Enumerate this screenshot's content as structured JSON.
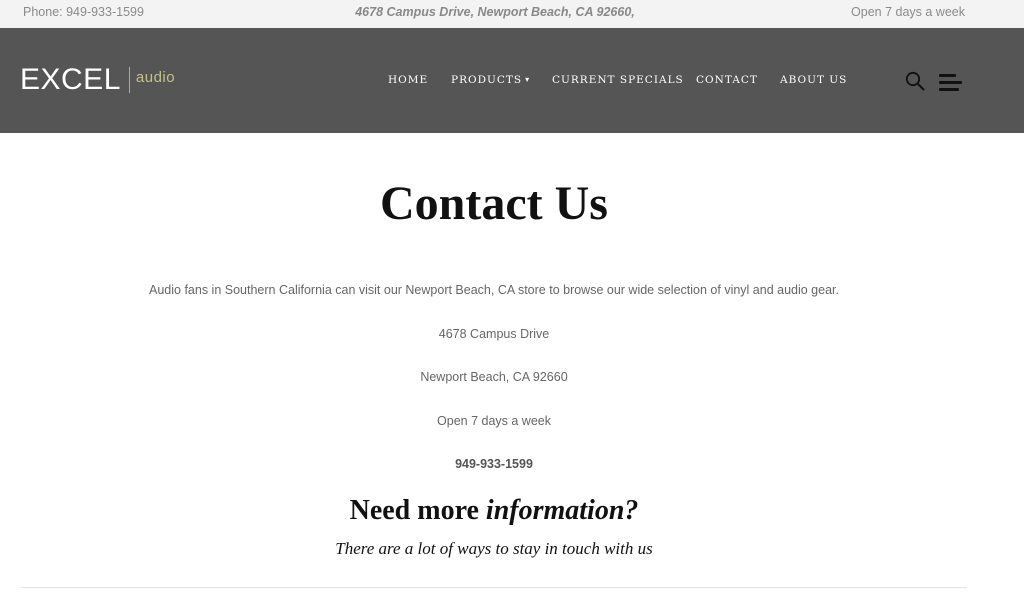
{
  "topbar": {
    "phone": "Phone: 949-933-1599",
    "address": "4678 Campus Drive, Newport Beach, CA 92660,",
    "hours": "Open 7 days a week"
  },
  "logo": {
    "primary": "EXCEL",
    "secondary": "audio"
  },
  "nav": {
    "items": [
      {
        "label": "HOME"
      },
      {
        "label": "PRODUCTS",
        "has_dropdown": true
      },
      {
        "label": "CURRENT SPECIALS"
      },
      {
        "label": "CONTACT"
      },
      {
        "label": "ABOUT US"
      }
    ],
    "caret": "▾",
    "icons": [
      "search-icon",
      "hamburger-icon"
    ]
  },
  "page": {
    "title": "Contact Us",
    "intro": "Audio fans in Southern California can visit our Newport Beach, CA store to browse our wide selection of vinyl and audio gear.",
    "street": "4678 Campus Drive",
    "city": "Newport Beach, CA 92660",
    "open": "Open 7 days a week",
    "phone": "949-933-1599",
    "need_plain": "Need more ",
    "need_italic": "information?",
    "touch": "There are a lot of ways to stay in touch with us"
  },
  "colors": {
    "topbar_bg": "#f3f3f3",
    "navbar_bg": "#555555",
    "logo_accent": "#c8bf8c",
    "text": "#666666",
    "heading": "#111111"
  }
}
